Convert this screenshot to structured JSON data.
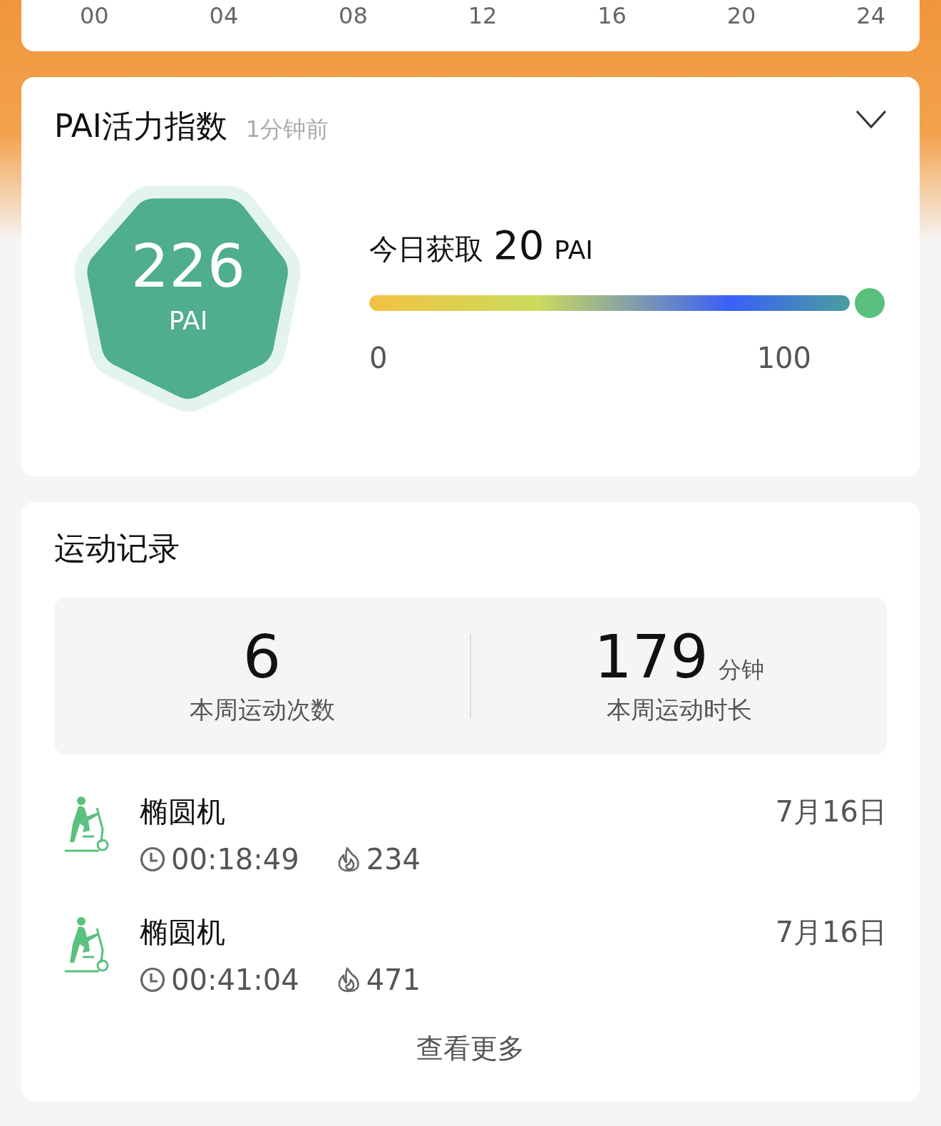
{
  "timeline_card": {
    "axis_labels": [
      "00",
      "04",
      "08",
      "12",
      "16",
      "20",
      "24"
    ]
  },
  "pai_card": {
    "title": "PAI活力指数",
    "updated": "1分钟前",
    "expanded": false,
    "score": "226",
    "score_unit": "PAI",
    "today_label": "今日获取",
    "today_value": "20",
    "today_unit": "PAI",
    "scale_min": "0",
    "scale_max": "100"
  },
  "workout_card": {
    "title": "运动记录",
    "stats": [
      {
        "value": "6",
        "label": "本周运动次数"
      },
      {
        "value": "179",
        "unit": "分钟",
        "label": "本周运动时长"
      }
    ],
    "records": [
      {
        "name": "椭圆机",
        "duration": "00:18:49",
        "calories": "234",
        "date": "7月16日"
      },
      {
        "name": "椭圆机",
        "duration": "00:41:04",
        "calories": "471",
        "date": "7月16日"
      }
    ],
    "more": "查看更多"
  }
}
